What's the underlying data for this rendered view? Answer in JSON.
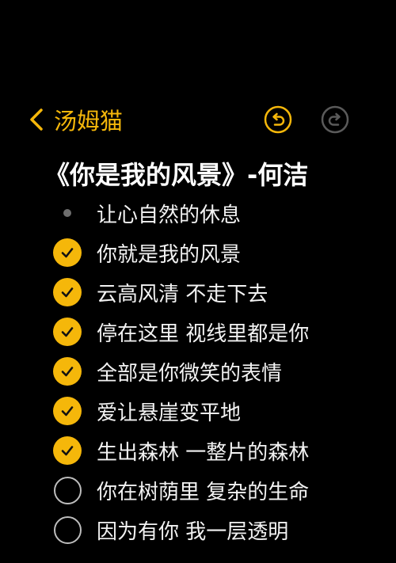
{
  "nav": {
    "back_label": "汤姆猫",
    "back_icon": "chevron-left-icon",
    "undo_icon": "undo-icon",
    "redo_icon": "redo-icon",
    "accent_color": "#f5b70a"
  },
  "note": {
    "title": "《你是我的风景》-何洁"
  },
  "list": {
    "items": [
      {
        "text": "让心自然的休息",
        "marker": "bullet"
      },
      {
        "text": "你就是我的风景",
        "marker": "checked"
      },
      {
        "text": "云高风清 不走下去",
        "marker": "checked"
      },
      {
        "text": "停在这里 视线里都是你",
        "marker": "checked"
      },
      {
        "text": "全部是你微笑的表情",
        "marker": "checked"
      },
      {
        "text": "爱让悬崖变平地",
        "marker": "checked"
      },
      {
        "text": "生出森林 一整片的森林",
        "marker": "checked"
      },
      {
        "text": "你在树荫里 复杂的生命",
        "marker": "unchecked"
      },
      {
        "text": "因为有你 我一层透明",
        "marker": "unchecked"
      }
    ]
  }
}
